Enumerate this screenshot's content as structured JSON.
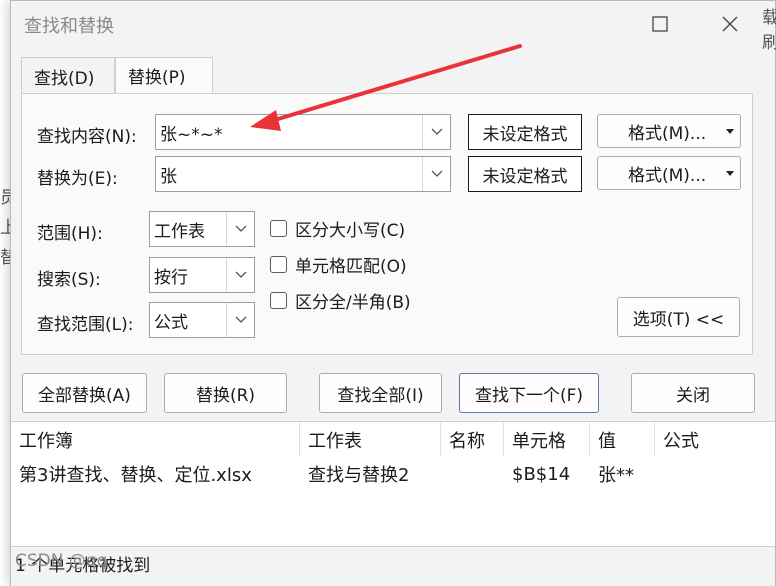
{
  "window": {
    "title": "查找和替换"
  },
  "tabs": [
    {
      "label": "查找(D)"
    },
    {
      "label": "替换(P)"
    }
  ],
  "find": {
    "label": "查找内容(N):",
    "value": "张~*~*",
    "format_status": "未设定格式",
    "format_button": "格式(M)..."
  },
  "replace": {
    "label": "替换为(E):",
    "value": "张",
    "format_status": "未设定格式",
    "format_button": "格式(M)..."
  },
  "options": {
    "scope_label": "范围(H):",
    "scope_value": "工作表",
    "search_label": "搜索(S):",
    "search_value": "按行",
    "lookin_label": "查找范围(L):",
    "lookin_value": "公式",
    "match_case": "区分大小写(C)",
    "match_cell": "单元格匹配(O)",
    "match_width": "区分全/半角(B)",
    "options_button": "选项(T) <<"
  },
  "actions": {
    "replace_all": "全部替换(A)",
    "replace": "替换(R)",
    "find_all": "查找全部(I)",
    "find_next": "查找下一个(F)",
    "close": "关闭"
  },
  "results": {
    "columns": [
      "工作簿",
      "工作表",
      "名称",
      "单元格",
      "值",
      "公式"
    ],
    "rows": [
      [
        "第3讲查找、替换、定位.xlsx",
        "查找与替换2",
        "",
        "$B$14",
        "张**",
        ""
      ]
    ]
  },
  "status": "1 个单元格被找到",
  "background": {
    "edge_chars": [
      "员",
      "上",
      "替"
    ],
    "right_chars": [
      "载",
      "刷"
    ]
  },
  "watermark": "CSDN @qq",
  "colors": {
    "arrow": "#e8333a",
    "primary_border": "#5a7aa8"
  }
}
